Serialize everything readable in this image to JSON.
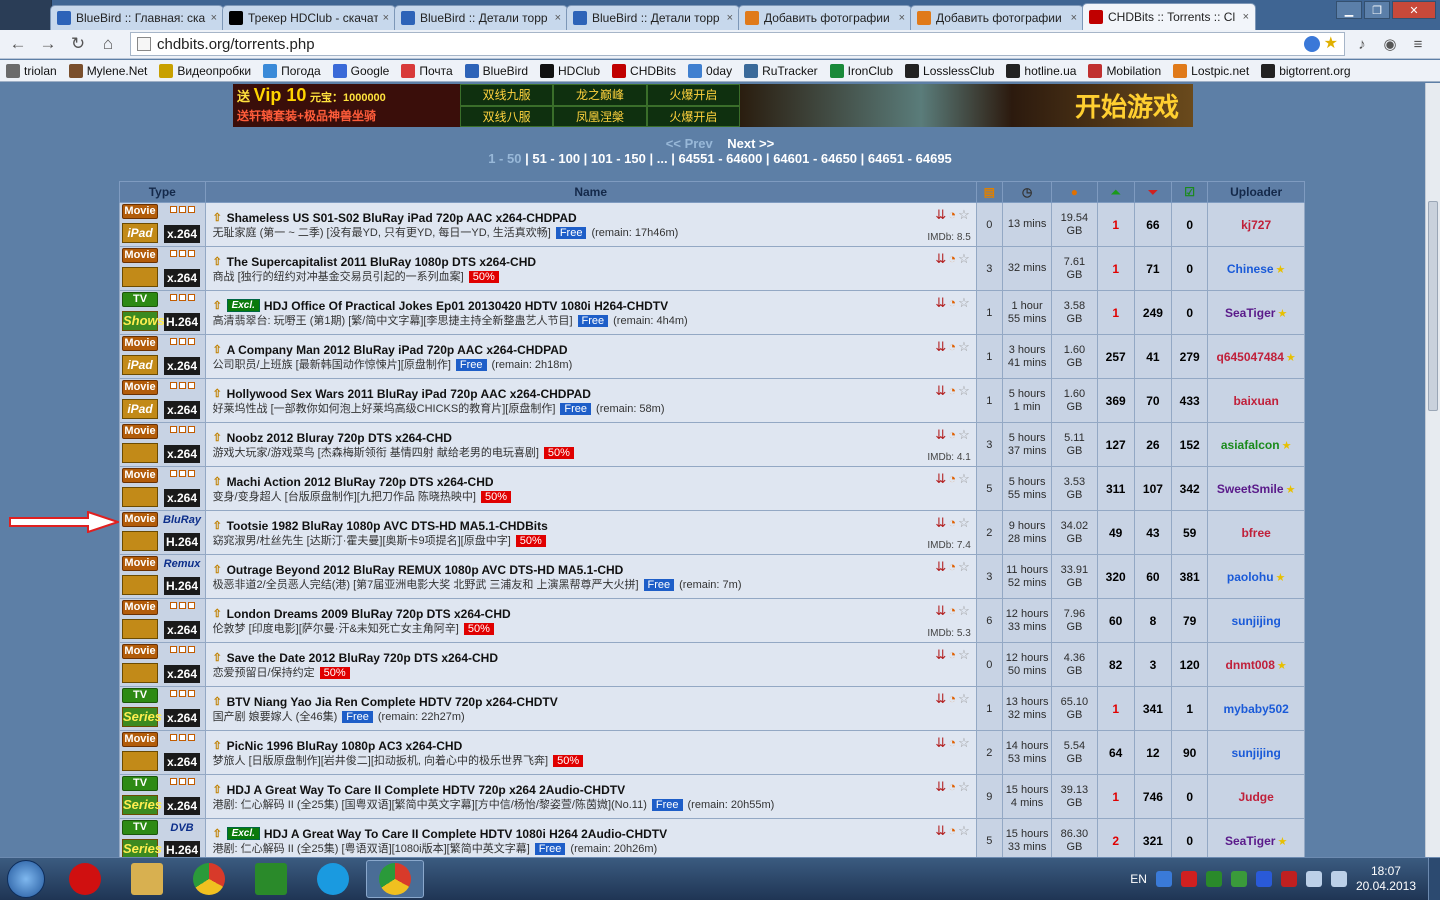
{
  "browser": {
    "tabs": [
      {
        "title": "BlueBird :: Главная: ска",
        "color": "#2d63b8",
        "active": false
      },
      {
        "title": "Трекер HDClub - скачать",
        "color": "#000000",
        "active": false
      },
      {
        "title": "BlueBird :: Детали торр",
        "color": "#2d63b8",
        "active": false
      },
      {
        "title": "BlueBird :: Детали торр",
        "color": "#2d63b8",
        "active": false
      },
      {
        "title": "Добавить фотографии",
        "color": "#e07a1a",
        "active": false
      },
      {
        "title": "Добавить фотографии",
        "color": "#e07a1a",
        "active": false
      },
      {
        "title": "CHDBits :: Torrents :: Cl",
        "color": "#c00000",
        "active": true
      }
    ],
    "tab_close": "×",
    "url": "chdbits.org/torrents.php",
    "bookmarks": [
      {
        "label": "triolan",
        "color": "#6b6b6b"
      },
      {
        "label": "Mylene.Net",
        "color": "#7a4f2c"
      },
      {
        "label": "Видеопробки",
        "color": "#c8a000"
      },
      {
        "label": "Погода",
        "color": "#3a8ad8"
      },
      {
        "label": "Google",
        "color": "#3a6ad8"
      },
      {
        "label": "Почта",
        "color": "#d83a3a"
      },
      {
        "label": "BlueBird",
        "color": "#2d63b8"
      },
      {
        "label": "HDClub",
        "color": "#111111"
      },
      {
        "label": "CHDBits",
        "color": "#c00000"
      },
      {
        "label": "0day",
        "color": "#4080d0"
      },
      {
        "label": "RuTracker",
        "color": "#3a6a9a"
      },
      {
        "label": "IronClub",
        "color": "#1a8a3a"
      },
      {
        "label": "LosslessClub",
        "color": "#222222"
      },
      {
        "label": "hotline.ua",
        "color": "#222222"
      },
      {
        "label": "Mobilation",
        "color": "#c03030"
      },
      {
        "label": "Lostpic.net",
        "color": "#e07a1a"
      },
      {
        "label": "bigtorrent.org",
        "color": "#222222"
      }
    ]
  },
  "banner": {
    "vip_text": "送",
    "vip_label": "Vip 10",
    "vip_sub": "元宝：1000000",
    "line2": "送轩辕套装+极品神兽坐骑",
    "grid": [
      "双线九服",
      "龙之巅峰",
      "火爆开启",
      "双线八服",
      "凤凰涅槃",
      "火爆开启"
    ],
    "right_text": "开始游戏"
  },
  "pager": {
    "prev": "<< Prev",
    "next": "Next >>",
    "pages": [
      "1 - 50",
      "51 - 100",
      "101 - 150",
      "...",
      "64551 - 64600",
      "64601 - 64650",
      "64651 - 64695"
    ]
  },
  "table": {
    "headers": {
      "type": "Type",
      "name": "Name",
      "uploader": "Uploader"
    },
    "rows": [
      {
        "t": "Movie",
        "sub": "iPad",
        "codec": "x.264",
        "title": "Shameless US S01-S02 BluRay iPad 720p AAC x264-CHDPAD",
        "desc": "无耻家庭 (第一 ~ 二季) [没有最YD, 只有更YD, 每日一YD, 生活真欢畅]",
        "promo": "Free",
        "remain": "(remain: 17h46m)",
        "imdb": "IMDb: 8.5",
        "c": "0",
        "time": [
          "13 mins"
        ],
        "size": [
          "19.54",
          "GB"
        ],
        "s": "1",
        "sred": true,
        "l": "66",
        "d": "0",
        "u": "kj727",
        "ucolor": "#c0203a",
        "star": false
      },
      {
        "t": "Movie",
        "sub": "",
        "codec": "x.264",
        "title": "The Supercapitalist 2011 BluRay 1080p DTS x264-CHD",
        "desc": "商战 [独行的纽约对冲基金交易员引起的一系列血案]",
        "promo": "50%",
        "remain": "",
        "imdb": "",
        "c": "3",
        "time": [
          "32 mins"
        ],
        "size": [
          "7.61",
          "GB"
        ],
        "s": "1",
        "sred": true,
        "l": "71",
        "d": "0",
        "u": "Chinese",
        "ucolor": "#1a5ad8",
        "star": true
      },
      {
        "t": "TV",
        "sub": "Shows",
        "codec": "H.264",
        "excl": true,
        "title": "HDJ Office Of Practical Jokes Ep01 20130420 HDTV 1080i H264-CHDTV",
        "desc": "高清翡翠台: 玩嘢王 (第1期) [繁/简中文字幕][李思捷主持全新整蛊艺人节目]",
        "promo": "Free",
        "remain": "(remain: 4h4m)",
        "imdb": "",
        "c": "1",
        "time": [
          "1 hour",
          "55 mins"
        ],
        "size": [
          "3.58",
          "GB"
        ],
        "s": "1",
        "sred": true,
        "l": "249",
        "d": "0",
        "u": "SeaTiger",
        "ucolor": "#5a1a8a",
        "star": true
      },
      {
        "t": "Movie",
        "sub": "iPad",
        "codec": "x.264",
        "title": "A Company Man 2012 BluRay iPad 720p AAC x264-CHDPAD",
        "desc": "公司职员/上班族 [最新韩国动作惊悚片][原盘制作]",
        "promo": "Free",
        "remain": "(remain: 2h18m)",
        "imdb": "",
        "c": "1",
        "time": [
          "3 hours",
          "41 mins"
        ],
        "size": [
          "1.60",
          "GB"
        ],
        "s": "257",
        "sred": false,
        "l": "41",
        "d": "279",
        "u": "q645047484",
        "ucolor": "#c0203a",
        "star": true
      },
      {
        "t": "Movie",
        "sub": "iPad",
        "codec": "x.264",
        "title": "Hollywood Sex Wars 2011 BluRay iPad 720p AAC x264-CHDPAD",
        "desc": "好莱坞性战 [一部教你如何泡上好莱坞高级CHICKS的教育片][原盘制作]",
        "promo": "Free",
        "remain": "(remain: 58m)",
        "imdb": "",
        "c": "1",
        "time": [
          "5 hours",
          "1 min"
        ],
        "size": [
          "1.60",
          "GB"
        ],
        "s": "369",
        "sred": false,
        "l": "70",
        "d": "433",
        "u": "baixuan",
        "ucolor": "#c0203a",
        "star": false
      },
      {
        "t": "Movie",
        "sub": "",
        "codec": "x.264",
        "title": "Noobz 2012 Bluray 720p DTS x264-CHD",
        "desc": "游戏大玩家/游戏菜鸟 [杰森梅斯领衔 基情四射 献给老男的电玩喜剧]",
        "promo": "50%",
        "remain": "",
        "imdb": "IMDb: 4.1",
        "c": "3",
        "time": [
          "5 hours",
          "37 mins"
        ],
        "size": [
          "5.11",
          "GB"
        ],
        "s": "127",
        "sred": false,
        "l": "26",
        "d": "152",
        "u": "asiafalcon",
        "ucolor": "#1a8a1a",
        "star": true
      },
      {
        "t": "Movie",
        "sub": "",
        "codec": "x.264",
        "title": "Machi Action 2012 BluRay 720p DTS x264-CHD",
        "desc": "变身/变身超人 [台版原盘制作][九把刀作品 陈晓热映中]",
        "promo": "50%",
        "remain": "",
        "imdb": "",
        "c": "5",
        "time": [
          "5 hours",
          "55 mins"
        ],
        "size": [
          "3.53",
          "GB"
        ],
        "s": "311",
        "sred": false,
        "l": "107",
        "d": "342",
        "u": "SweetSmile",
        "ucolor": "#5a1a8a",
        "star": true
      },
      {
        "t": "Movie",
        "sub": "",
        "codec": "H.264",
        "brand": "BluRay",
        "title": "Tootsie 1982 BluRay 1080p AVC DTS-HD MA5.1-CHDBits",
        "desc": "窈窕淑男/杜丝先生 [达斯汀·霍夫曼][奥斯卡9项提名][原盘中字]",
        "promo": "50%",
        "remain": "",
        "imdb": "IMDb: 7.4",
        "c": "2",
        "time": [
          "9 hours",
          "28 mins"
        ],
        "size": [
          "34.02",
          "GB"
        ],
        "s": "49",
        "sred": false,
        "l": "43",
        "d": "59",
        "u": "bfree",
        "ucolor": "#c0203a",
        "star": false
      },
      {
        "t": "Movie",
        "sub": "",
        "codec": "H.264",
        "brand": "Remux",
        "title": "Outrage Beyond 2012 BluRay REMUX 1080p AVC DTS-HD MA5.1-CHD",
        "desc": "极恶非道2/全员恶人完结(港) [第7届亚洲电影大奖 北野武 三浦友和 上演黑帮尊严大火拼]",
        "promo": "Free",
        "remain": "(remain: 7m)",
        "imdb": "",
        "c": "3",
        "time": [
          "11 hours",
          "52 mins"
        ],
        "size": [
          "33.91",
          "GB"
        ],
        "s": "320",
        "sred": false,
        "l": "60",
        "d": "381",
        "u": "paolohu",
        "ucolor": "#1a5ad8",
        "star": true
      },
      {
        "t": "Movie",
        "sub": "",
        "codec": "x.264",
        "title": "London Dreams 2009 BluRay 720p DTS x264-CHD",
        "desc": "伦敦梦 [印度电影][萨尔曼·汗&未知死亡女主角阿辛]",
        "promo": "50%",
        "remain": "",
        "imdb": "IMDb: 5.3",
        "c": "6",
        "time": [
          "12 hours",
          "33 mins"
        ],
        "size": [
          "7.96",
          "GB"
        ],
        "s": "60",
        "sred": false,
        "l": "8",
        "d": "79",
        "u": "sunjijing",
        "ucolor": "#1a5ad8",
        "star": false
      },
      {
        "t": "Movie",
        "sub": "",
        "codec": "x.264",
        "title": "Save the Date 2012 BluRay 720p DTS x264-CHD",
        "desc": "恋爱预留日/保持约定",
        "promo": "50%",
        "remain": "",
        "imdb": "",
        "c": "0",
        "time": [
          "12 hours",
          "50 mins"
        ],
        "size": [
          "4.36",
          "GB"
        ],
        "s": "82",
        "sred": false,
        "l": "3",
        "d": "120",
        "u": "dnmt008",
        "ucolor": "#c0203a",
        "star": true
      },
      {
        "t": "TV",
        "sub": "Series",
        "codec": "x.264",
        "title": "BTV Niang Yao Jia Ren Complete HDTV 720p x264-CHDTV",
        "desc": "国产剧 娘要嫁人 (全46集)",
        "promo": "Free",
        "remain": "(remain: 22h27m)",
        "imdb": "",
        "c": "1",
        "time": [
          "13 hours",
          "32 mins"
        ],
        "size": [
          "65.10",
          "GB"
        ],
        "s": "1",
        "sred": true,
        "l": "341",
        "d": "1",
        "u": "mybaby502",
        "ucolor": "#1a5ad8",
        "star": false
      },
      {
        "t": "Movie",
        "sub": "",
        "codec": "x.264",
        "title": "PicNic 1996 BluRay 1080p AC3 x264-CHD",
        "desc": "梦旅人 [日版原盘制作][岩井俊二][扣动扳机, 向着心中的极乐世界飞奔]",
        "promo": "50%",
        "remain": "",
        "imdb": "",
        "c": "2",
        "time": [
          "14 hours",
          "53 mins"
        ],
        "size": [
          "5.54",
          "GB"
        ],
        "s": "64",
        "sred": false,
        "l": "12",
        "d": "90",
        "u": "sunjijing",
        "ucolor": "#1a5ad8",
        "star": false
      },
      {
        "t": "TV",
        "sub": "Series",
        "codec": "x.264",
        "title": "HDJ A Great Way To Care II Complete HDTV 720p x264 2Audio-CHDTV",
        "desc": "港剧: 仁心解码 II (全25集) [国粤双语][繁简中英文字幕][方中信/杨怡/黎姿萱/陈茵媺](No.11)",
        "promo": "Free",
        "remain": "(remain: 20h55m)",
        "imdb": "",
        "c": "9",
        "time": [
          "15 hours",
          "4 mins"
        ],
        "size": [
          "39.13",
          "GB"
        ],
        "s": "1",
        "sred": true,
        "l": "746",
        "d": "0",
        "u": "Judge",
        "ucolor": "#c0203a",
        "star": false
      },
      {
        "t": "TV",
        "sub": "Series",
        "codec": "H.264",
        "excl": true,
        "brand": "DVB",
        "title": "HDJ A Great Way To Care II Complete HDTV 1080i H264 2Audio-CHDTV",
        "desc": "港剧: 仁心解码 II (全25集) [粤语双语][1080i版本][繁简中英文字幕]",
        "promo": "Free",
        "remain": "(remain: 20h26m)",
        "imdb": "",
        "c": "5",
        "time": [
          "15 hours",
          "33 mins"
        ],
        "size": [
          "86.30",
          "GB"
        ],
        "s": "2",
        "sred": true,
        "l": "321",
        "d": "0",
        "u": "SeaTiger",
        "ucolor": "#5a1a8a",
        "star": true
      }
    ]
  },
  "taskbar": {
    "lang": "EN",
    "time": "18:07",
    "date": "20.04.2013"
  }
}
